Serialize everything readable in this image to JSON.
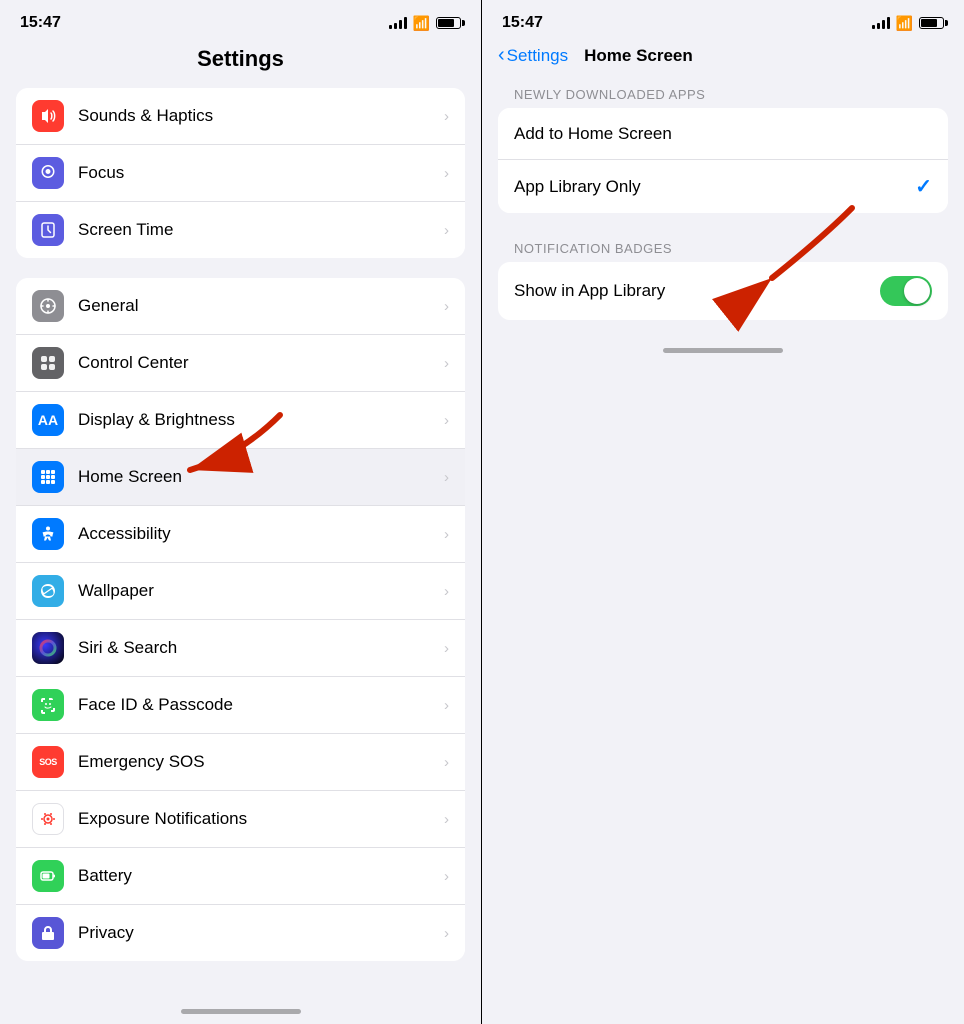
{
  "left": {
    "status": {
      "time": "15:47"
    },
    "title": "Settings",
    "group1": [
      {
        "id": "sounds",
        "icon_bg": "icon-red",
        "icon": "🔔",
        "label": "Sounds & Haptics"
      },
      {
        "id": "focus",
        "icon_bg": "icon-indigo",
        "icon": "🌙",
        "label": "Focus"
      },
      {
        "id": "screentime",
        "icon_bg": "icon-indigo",
        "icon": "⏱",
        "label": "Screen Time"
      }
    ],
    "group2": [
      {
        "id": "general",
        "icon_bg": "icon-gray",
        "icon": "⚙️",
        "label": "General"
      },
      {
        "id": "controlcenter",
        "icon_bg": "icon-gray",
        "icon": "🎛",
        "label": "Control Center"
      },
      {
        "id": "displaybrightness",
        "icon_bg": "icon-blue",
        "icon": "AA",
        "label": "Display & Brightness"
      },
      {
        "id": "homescreen",
        "icon_bg": "icon-blue-grid",
        "icon": "⊞",
        "label": "Home Screen"
      },
      {
        "id": "accessibility",
        "icon_bg": "icon-blue",
        "icon": "♿",
        "label": "Accessibility"
      },
      {
        "id": "wallpaper",
        "icon_bg": "icon-teal",
        "icon": "❋",
        "label": "Wallpaper"
      },
      {
        "id": "siri",
        "icon_bg": "icon-siri",
        "icon": "◉",
        "label": "Siri & Search"
      },
      {
        "id": "faceid",
        "icon_bg": "icon-green-face",
        "icon": "😀",
        "label": "Face ID & Passcode"
      },
      {
        "id": "sos",
        "icon_bg": "icon-sos",
        "icon": "SOS",
        "label": "Emergency SOS"
      },
      {
        "id": "exposure",
        "icon_bg": "icon-exposure",
        "icon": "💢",
        "label": "Exposure Notifications"
      },
      {
        "id": "battery",
        "icon_bg": "icon-battery",
        "icon": "🔋",
        "label": "Battery"
      },
      {
        "id": "privacy",
        "icon_bg": "icon-privacy",
        "icon": "✋",
        "label": "Privacy"
      }
    ]
  },
  "right": {
    "status": {
      "time": "15:47"
    },
    "back_label": "Settings",
    "title": "Home Screen",
    "section1_label": "NEWLY DOWNLOADED APPS",
    "options": [
      {
        "id": "add-to-home",
        "label": "Add to Home Screen",
        "checked": false
      },
      {
        "id": "app-library-only",
        "label": "App Library Only",
        "checked": true
      }
    ],
    "section2_label": "NOTIFICATION BADGES",
    "toggles": [
      {
        "id": "show-app-library",
        "label": "Show in App Library",
        "on": true
      }
    ]
  }
}
